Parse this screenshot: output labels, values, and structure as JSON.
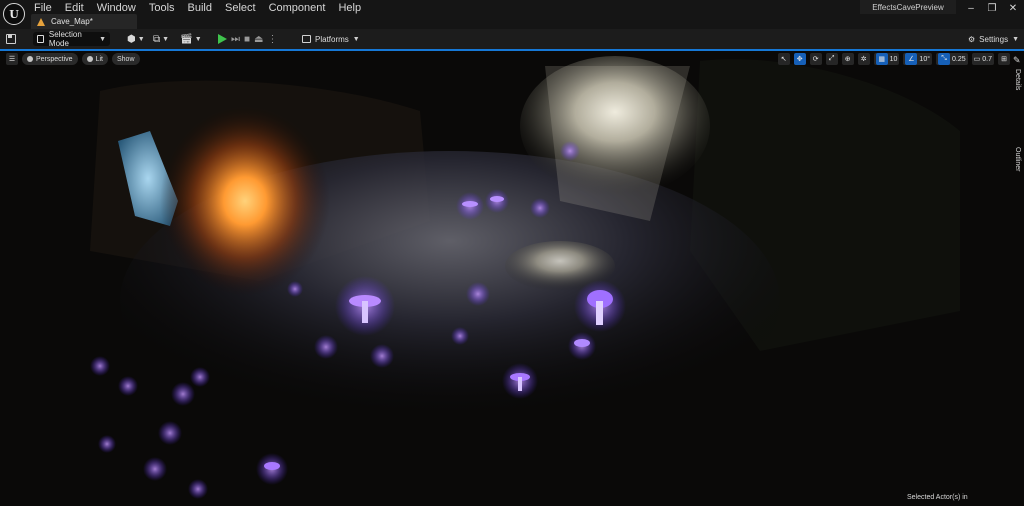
{
  "app": {
    "logo_letter": "U",
    "menu": [
      "File",
      "Edit",
      "Window",
      "Tools",
      "Build",
      "Select",
      "Component",
      "Help"
    ],
    "tab_label": "Cave_Map*",
    "project_name": "EffectsCavePreview",
    "window_buttons": {
      "minimize": "–",
      "restore": "❐",
      "close": "✕"
    }
  },
  "toolbar": {
    "save_icon": "save-icon",
    "mode_label": "Selection Mode",
    "platforms_label": "Platforms",
    "settings_label": "Settings"
  },
  "viewport": {
    "menu_icon": "☰",
    "view_mode": "Perspective",
    "lighting_mode": "Lit",
    "show_label": "Show",
    "grid_snap": "10",
    "rotation_snap": "10°",
    "scale_snap": "0.25",
    "camera_speed": "0.7"
  },
  "side_panel": {
    "details_label": "Details",
    "outliner_label": "Outliner"
  },
  "status": {
    "selected_actors": "Selected Actor(s) in"
  },
  "colors": {
    "accent": "#1678d6",
    "play_green": "#3fc34d",
    "mushroom_glow": "#a05cff",
    "fire_glow": "#ff8a2a"
  }
}
